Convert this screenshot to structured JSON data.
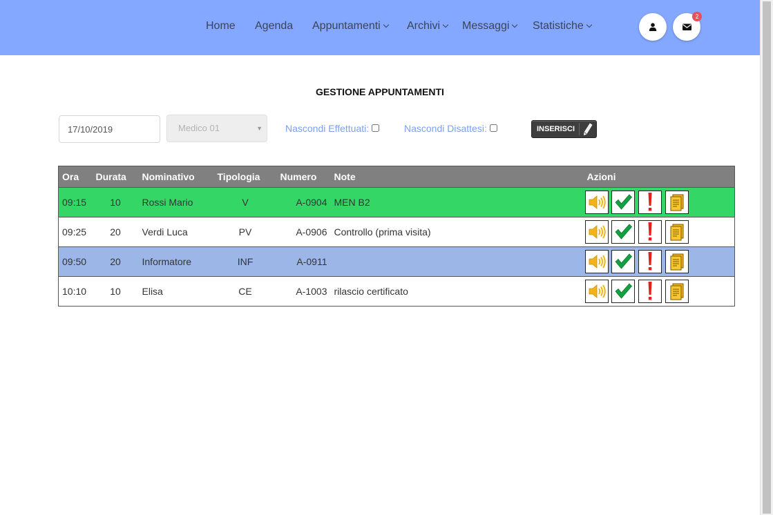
{
  "nav": {
    "items": [
      {
        "label": "Home",
        "dropdown": false
      },
      {
        "label": "Agenda",
        "dropdown": false
      },
      {
        "label": "Appuntamenti",
        "dropdown": true
      },
      {
        "label": "Archivi",
        "dropdown": true
      },
      {
        "label": "Messaggi",
        "dropdown": true
      },
      {
        "label": "Statistiche",
        "dropdown": true
      }
    ],
    "user_icon": "user-icon",
    "messages_icon": "envelope-icon",
    "messages_badge": "2",
    "bar_color": "#84a8ff"
  },
  "page": {
    "title": "GESTIONE APPUNTAMENTI"
  },
  "filters": {
    "date_value": "17/10/2019",
    "doctor_selected": "Medico 01",
    "hide_done_label": "Nascondi Effettuati:",
    "hide_missed_label": "Nascondi Disattesi:",
    "insert_label": "INSERISCI"
  },
  "table": {
    "headers": {
      "ora": "Ora",
      "durata": "Durata",
      "nominativo": "Nominativo",
      "tipologia": "Tipologia",
      "numero": "Numero",
      "note": "Note",
      "azioni": "Azioni"
    },
    "rows": [
      {
        "ora": "09:15",
        "durata": "10",
        "nominativo": "Rossi Mario",
        "tipologia": "V",
        "numero": "A-0904",
        "note": "MEN B2",
        "status_color": "#34d765"
      },
      {
        "ora": "09:25",
        "durata": "20",
        "nominativo": "Verdi Luca",
        "tipologia": "PV",
        "numero": "A-0906",
        "note": "Controllo (prima visita)",
        "status_color": "#ffffff"
      },
      {
        "ora": "09:50",
        "durata": "20",
        "nominativo": "Informatore",
        "tipologia": "INF",
        "numero": "A-0911",
        "note": "",
        "status_color": "#9cb6e8"
      },
      {
        "ora": "10:10",
        "durata": "10",
        "nominativo": "Elisa",
        "tipologia": "CE",
        "numero": "A-1003",
        "note": "rilascio certificato",
        "status_color": "#ffffff"
      }
    ],
    "action_icons": [
      "speaker-icon",
      "checkmark-icon",
      "exclamation-icon",
      "document-icon"
    ]
  }
}
